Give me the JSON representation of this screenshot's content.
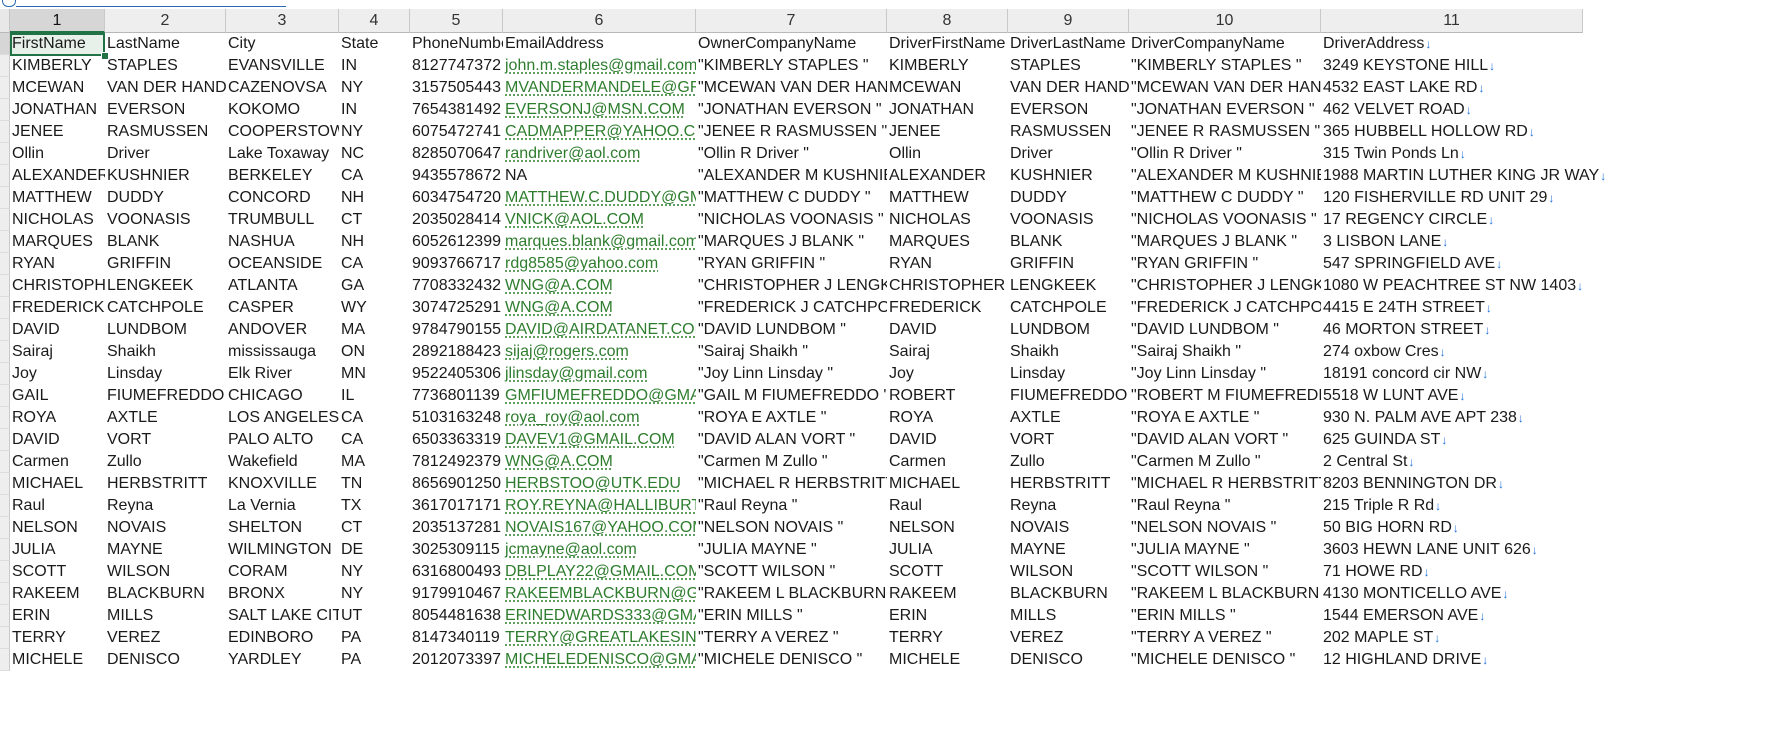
{
  "columns": [
    {
      "label": "1",
      "width": 95
    },
    {
      "label": "2",
      "width": 121
    },
    {
      "label": "3",
      "width": 113
    },
    {
      "label": "4",
      "width": 71
    },
    {
      "label": "5",
      "width": 93
    },
    {
      "label": "6",
      "width": 193
    },
    {
      "label": "7",
      "width": 191
    },
    {
      "label": "8",
      "width": 121
    },
    {
      "label": "9",
      "width": 121
    },
    {
      "label": "10",
      "width": 192
    },
    {
      "label": "11",
      "width": 262
    }
  ],
  "selected_cell": "FirstName",
  "header_row": [
    "FirstName",
    "LastName",
    "City",
    "State",
    "PhoneNumber",
    "EmailAddress",
    "OwnerCompanyName",
    "DriverFirstName",
    "DriverLastName",
    "DriverCompanyName",
    "DriverAddress"
  ],
  "line_break_marker": "↓",
  "rows": [
    [
      "KIMBERLY",
      "STAPLES",
      "EVANSVILLE",
      "IN",
      "8127747372",
      "john.m.staples@gmail.com",
      "\"KIMBERLY STAPLES \"",
      "KIMBERLY",
      "STAPLES",
      "\"KIMBERLY STAPLES \"",
      "3249 KEYSTONE HILL"
    ],
    [
      "MCEWAN",
      "VAN DER HANDEL",
      "CAZENOVSA",
      "NY",
      "3157505443",
      "MVANDERMANDELE@GFNET.COM",
      "\"MCEWAN VAN DER HANDEL \"",
      "MCEWAN",
      "VAN DER HANDEL",
      "\"MCEWAN VAN DER HANDEL \"",
      "4532 EAST LAKE RD"
    ],
    [
      "JONATHAN",
      "EVERSON",
      "KOKOMO",
      "IN",
      "7654381492",
      "EVERSONJ@MSN.COM",
      "\"JONATHAN EVERSON \"",
      "JONATHAN",
      "EVERSON",
      "\"JONATHAN EVERSON \"",
      "462 VELVET ROAD"
    ],
    [
      "JENEE",
      "RASMUSSEN",
      "COOPERSTOWN",
      "NY",
      "6075472741",
      "CADMAPPER@YAHOO.COM",
      "\"JENEE R RASMUSSEN \"",
      "JENEE",
      "RASMUSSEN",
      "\"JENEE R RASMUSSEN \"",
      "365 HUBBELL HOLLOW RD"
    ],
    [
      "Ollin",
      "Driver",
      "Lake Toxaway",
      "NC",
      "8285070647",
      "randriver@aol.com",
      "\"Ollin R Driver \"",
      "Ollin",
      "Driver",
      "\"Ollin R Driver \"",
      "315 Twin Ponds Ln"
    ],
    [
      "ALEXANDER",
      "KUSHNIER",
      "BERKELEY",
      "CA",
      "9435578672",
      "NA",
      "\"ALEXANDER M KUSHNIER \"",
      "ALEXANDER",
      "KUSHNIER",
      "\"ALEXANDER M KUSHNIER \"",
      "1988 MARTIN LUTHER KING JR WAY"
    ],
    [
      "MATTHEW",
      "DUDDY",
      "CONCORD",
      "NH",
      "6034754720",
      "MATTHEW.C.DUDDY@GMAIL.COM",
      "\"MATTHEW C DUDDY \"",
      "MATTHEW",
      "DUDDY",
      "\"MATTHEW C DUDDY \"",
      "120 FISHERVILLE RD UNIT 29"
    ],
    [
      "NICHOLAS",
      "VOONASIS",
      "TRUMBULL",
      "CT",
      "2035028414",
      "VNICK@AOL.COM",
      "\"NICHOLAS VOONASIS \"",
      "NICHOLAS",
      "VOONASIS",
      "\"NICHOLAS VOONASIS \"",
      "17 REGENCY CIRCLE"
    ],
    [
      "MARQUES",
      "BLANK",
      "NASHUA",
      "NH",
      "6052612399",
      "marques.blank@gmail.com",
      "\"MARQUES J BLANK \"",
      "MARQUES",
      "BLANK",
      "\"MARQUES J BLANK \"",
      "3 LISBON LANE"
    ],
    [
      "RYAN",
      "GRIFFIN",
      "OCEANSIDE",
      "CA",
      "9093766717",
      "rdg8585@yahoo.com",
      "\"RYAN GRIFFIN \"",
      "RYAN",
      "GRIFFIN",
      "\"RYAN GRIFFIN \"",
      "547 SPRINGFIELD AVE"
    ],
    [
      "CHRISTOPHER",
      "LENGKEEK",
      "ATLANTA",
      "GA",
      "7708332432",
      "WNG@A.COM",
      "\"CHRISTOPHER J LENGKEEK \"",
      "CHRISTOPHER",
      "LENGKEEK",
      "\"CHRISTOPHER J LENGKEEK \"",
      "1080 W PEACHTREE ST NW 1403"
    ],
    [
      "FREDERICK",
      "CATCHPOLE",
      "CASPER",
      "WY",
      "3074725291",
      "WNG@A.COM",
      "\"FREDERICK J CATCHPOLE \"",
      "FREDERICK",
      "CATCHPOLE",
      "\"FREDERICK J CATCHPOLE \"",
      "4415 E 24TH STREET"
    ],
    [
      "DAVID",
      "LUNDBOM",
      "ANDOVER",
      "MA",
      "9784790155",
      "DAVID@AIRDATANET.COM",
      "\"DAVID LUNDBOM \"",
      "DAVID",
      "LUNDBOM",
      "\"DAVID LUNDBOM \"",
      "46 MORTON STREET"
    ],
    [
      "Sairaj",
      "Shaikh",
      "mississauga",
      "ON",
      "2892188423",
      "sijaj@rogers.com",
      "\"Sairaj Shaikh \"",
      "Sairaj",
      "Shaikh",
      "\"Sairaj Shaikh \"",
      "274 oxbow Cres"
    ],
    [
      "Joy",
      "Linsday",
      "Elk River",
      "MN",
      "9522405306",
      "jlinsday@gmail.com",
      "\"Joy Linn Linsday \"",
      "Joy",
      "Linsday",
      "\"Joy Linn Linsday \"",
      "18191 concord cir NW"
    ],
    [
      "GAIL",
      "FIUMEFREDDO",
      "CHICAGO",
      "IL",
      "7736801139",
      "GMFIUMEFREDDO@GMAIL.COM",
      "\"GAIL M FIUMEFREDDO \"",
      "ROBERT",
      "FIUMEFREDDO",
      "\"ROBERT M FIUMEFREDDO \"",
      "5518 W LUNT AVE"
    ],
    [
      "ROYA",
      "AXTLE",
      "LOS ANGELES",
      "CA",
      "5103163248",
      "roya_roy@aol.com",
      "\"ROYA E AXTLE \"",
      "ROYA",
      "AXTLE",
      "\"ROYA E AXTLE \"",
      "930 N. PALM AVE APT 238"
    ],
    [
      "DAVID",
      "VORT",
      "PALO ALTO",
      "CA",
      "6503363319",
      "DAVEV1@GMAIL.COM",
      "\"DAVID ALAN VORT \"",
      "DAVID",
      "VORT",
      "\"DAVID ALAN VORT \"",
      "625 GUINDA ST"
    ],
    [
      "Carmen",
      "Zullo",
      "Wakefield",
      "MA",
      "7812492379",
      "WNG@A.COM",
      "\"Carmen M Zullo \"",
      "Carmen",
      "Zullo",
      "\"Carmen M Zullo \"",
      "2 Central St"
    ],
    [
      "MICHAEL",
      "HERBSTRITT",
      "KNOXVILLE",
      "TN",
      "8656901250",
      "HERBSTOO@UTK.EDU",
      "\"MICHAEL R HERBSTRITT \"",
      "MICHAEL",
      "HERBSTRITT",
      "\"MICHAEL R HERBSTRITT \"",
      "8203 BENNINGTON DR"
    ],
    [
      "Raul",
      "Reyna",
      "La Vernia",
      "TX",
      "3617017171",
      "ROY.REYNA@HALLIBURTON.COM",
      "\"Raul Reyna \"",
      "Raul",
      "Reyna",
      "\"Raul Reyna \"",
      "215 Triple R Rd"
    ],
    [
      "NELSON",
      "NOVAIS",
      "SHELTON",
      "CT",
      "2035137281",
      "NOVAIS167@YAHOO.COM",
      "\"NELSON NOVAIS \"",
      "NELSON",
      "NOVAIS",
      "\"NELSON NOVAIS \"",
      "50 BIG HORN RD"
    ],
    [
      "JULIA",
      "MAYNE",
      "WILMINGTON",
      "DE",
      "3025309115",
      "jcmayne@aol.com",
      "\"JULIA MAYNE \"",
      "JULIA",
      "MAYNE",
      "\"JULIA MAYNE \"",
      "3603 HEWN LANE UNIT 626"
    ],
    [
      "SCOTT",
      "WILSON",
      "CORAM",
      "NY",
      "6316800493",
      "DBLPLAY22@GMAIL.COM",
      "\"SCOTT WILSON \"",
      "SCOTT",
      "WILSON",
      "\"SCOTT WILSON \"",
      "71 HOWE RD"
    ],
    [
      "RAKEEM",
      "BLACKBURN",
      "BRONX",
      "NY",
      "9179910467",
      "RAKEEMBLACKBURN@GMAIL.COM",
      "\"RAKEEM L BLACKBURN \"",
      "RAKEEM",
      "BLACKBURN",
      "\"RAKEEM L BLACKBURN \"",
      "4130 MONTICELLO AVE"
    ],
    [
      "ERIN",
      "MILLS",
      "SALT LAKE CITY",
      "UT",
      "8054481638",
      "ERINEDWARDS333@GMAIL.COM",
      "\"ERIN MILLS \"",
      "ERIN",
      "MILLS",
      "\"ERIN MILLS \"",
      "1544 EMERSON AVE"
    ],
    [
      "TERRY",
      "VEREZ",
      "EDINBORO",
      "PA",
      "8147340119",
      "TERRY@GREATLAKESINS.COM",
      "\"TERRY A VEREZ \"",
      "TERRY",
      "VEREZ",
      "\"TERRY A VEREZ \"",
      "202 MAPLE ST"
    ],
    [
      "MICHELE",
      "DENISCO",
      "YARDLEY",
      "PA",
      "2012073397",
      "MICHELEDENISCO@GMAIL.COM",
      "\"MICHELE DENISCO \"",
      "MICHELE",
      "DENISCO",
      "\"MICHELE DENISCO \"",
      "12 HIGHLAND DRIVE"
    ]
  ]
}
